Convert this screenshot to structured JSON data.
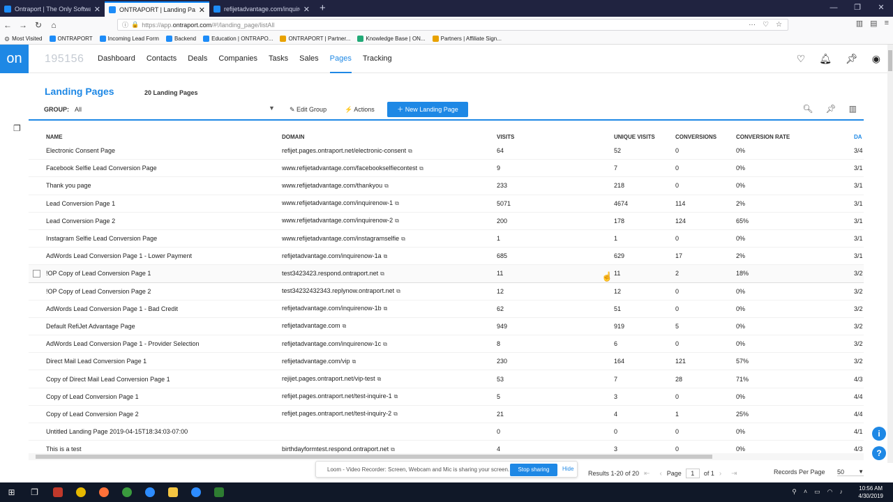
{
  "browser": {
    "tabs": [
      {
        "title": "Ontraport | The Only Software",
        "active": false
      },
      {
        "title": "ONTRAPORT | Landing Pages",
        "active": true
      },
      {
        "title": "refijetadvantage.com/inquiren",
        "active": false
      }
    ],
    "url_prefix": "https://app.",
    "url_domain": "ontraport.com",
    "url_path": "/#!/landing_page/listAll",
    "bookmarks": [
      "Most Visited",
      "ONTRAPORT",
      "Incoming Lead Form",
      "Backend",
      "Education | ONTRAPO...",
      "ONTRAPORT | Partner...",
      "Knowledge Base | ON...",
      "Partners | Affiliate Sign..."
    ]
  },
  "app": {
    "logo": "on",
    "account_id": "195156",
    "nav": [
      "Dashboard",
      "Contacts",
      "Deals",
      "Companies",
      "Tasks",
      "Sales",
      "Pages",
      "Tracking"
    ],
    "active_nav": "Pages"
  },
  "page": {
    "title": "Landing Pages",
    "count": "20 Landing Pages",
    "group_label": "GROUP:",
    "group_value": "All",
    "edit_group": "Edit Group",
    "actions": "Actions",
    "new_button": "New Landing Page"
  },
  "table": {
    "headers": [
      "NAME",
      "DOMAIN",
      "VISITS",
      "UNIQUE VISITS",
      "CONVERSIONS",
      "CONVERSION RATE",
      "DA"
    ],
    "rows": [
      {
        "name": "Electronic Consent Page",
        "domain": "refijet.pages.ontraport.net/electronic-consent",
        "visits": "64",
        "unique": "52",
        "conversions": "0",
        "rate": "0%",
        "date": "3/4"
      },
      {
        "name": "Facebook Selfie Lead Conversion Page",
        "domain": "www.refijetadvantage.com/facebookselfiecontest",
        "visits": "9",
        "unique": "7",
        "conversions": "0",
        "rate": "0%",
        "date": "3/1"
      },
      {
        "name": "Thank you page",
        "domain": "www.refijetadvantage.com/thankyou",
        "visits": "233",
        "unique": "218",
        "conversions": "0",
        "rate": "0%",
        "date": "3/1"
      },
      {
        "name": "Lead Conversion Page 1",
        "domain": "www.refijetadvantage.com/inquirenow-1",
        "visits": "5071",
        "unique": "4674",
        "conversions": "114",
        "rate": "2%",
        "date": "3/1"
      },
      {
        "name": "Lead Conversion Page 2",
        "domain": "www.refijetadvantage.com/inquirenow-2",
        "visits": "200",
        "unique": "178",
        "conversions": "124",
        "rate": "65%",
        "date": "3/1"
      },
      {
        "name": "Instagram Selfie Lead Conversion Page",
        "domain": "www.refijetadvantage.com/instagramselfie",
        "visits": "1",
        "unique": "1",
        "conversions": "0",
        "rate": "0%",
        "date": "3/1"
      },
      {
        "name": "AdWords Lead Conversion Page 1 - Lower Payment",
        "domain": "refijetadvantage.com/inquirenow-1a",
        "visits": "685",
        "unique": "629",
        "conversions": "17",
        "rate": "2%",
        "date": "3/1"
      },
      {
        "name": "!OP Copy of Lead Conversion Page 1",
        "domain": "test3423423.respond.ontraport.net",
        "visits": "11",
        "unique": "11",
        "conversions": "2",
        "rate": "18%",
        "date": "3/2",
        "hover": true
      },
      {
        "name": "!OP Copy of Lead Conversion Page 2",
        "domain": "test34232432343.replynow.ontraport.net",
        "visits": "12",
        "unique": "12",
        "conversions": "0",
        "rate": "0%",
        "date": "3/2"
      },
      {
        "name": "AdWords Lead Conversion Page 1 - Bad Credit",
        "domain": "refijetadvantage.com/inquirenow-1b",
        "visits": "62",
        "unique": "51",
        "conversions": "0",
        "rate": "0%",
        "date": "3/2"
      },
      {
        "name": "Default RefiJet Advantage Page",
        "domain": "refijetadvantage.com",
        "visits": "949",
        "unique": "919",
        "conversions": "5",
        "rate": "0%",
        "date": "3/2"
      },
      {
        "name": "AdWords Lead Conversion Page 1 - Provider Selection",
        "domain": "refijetadvantage.com/inquirenow-1c",
        "visits": "8",
        "unique": "6",
        "conversions": "0",
        "rate": "0%",
        "date": "3/2"
      },
      {
        "name": "Direct Mail Lead Conversion Page 1",
        "domain": "refijetadvantage.com/vip",
        "visits": "230",
        "unique": "164",
        "conversions": "121",
        "rate": "57%",
        "date": "3/2"
      },
      {
        "name": "Copy of Direct Mail Lead Conversion Page 1",
        "domain": "rejijet.pages.ontraport.net/vip-test",
        "visits": "53",
        "unique": "7",
        "conversions": "28",
        "rate": "71%",
        "date": "4/3"
      },
      {
        "name": "Copy of Lead Conversion Page 1",
        "domain": "refijet.pages.ontraport.net/test-inquire-1",
        "visits": "5",
        "unique": "3",
        "conversions": "0",
        "rate": "0%",
        "date": "4/4"
      },
      {
        "name": "Copy of Lead Conversion Page 2",
        "domain": "refijet.pages.ontraport.net/test-inquiry-2",
        "visits": "21",
        "unique": "4",
        "conversions": "1",
        "rate": "25%",
        "date": "4/4"
      },
      {
        "name": "Untitled Landing Page 2019-04-15T18:34:03-07:00",
        "domain": "",
        "visits": "0",
        "unique": "0",
        "conversions": "0",
        "rate": "0%",
        "date": "4/1"
      },
      {
        "name": "This is a test",
        "domain": "birthdayformtest.respond.ontraport.net",
        "visits": "4",
        "unique": "3",
        "conversions": "0",
        "rate": "0%",
        "date": "4/3"
      }
    ]
  },
  "loom": {
    "message": "Loom - Video Recorder: Screen, Webcam and Mic is sharing your screen.",
    "stop": "Stop sharing",
    "hide": "Hide"
  },
  "pager": {
    "results": "Results 1-20 of 20",
    "page_label": "Page",
    "page_value": "1",
    "of": "of 1",
    "rpp_label": "Records Per Page",
    "rpp_value": "50"
  },
  "taskbar": {
    "time": "10:56 AM",
    "date": "4/30/2019"
  }
}
